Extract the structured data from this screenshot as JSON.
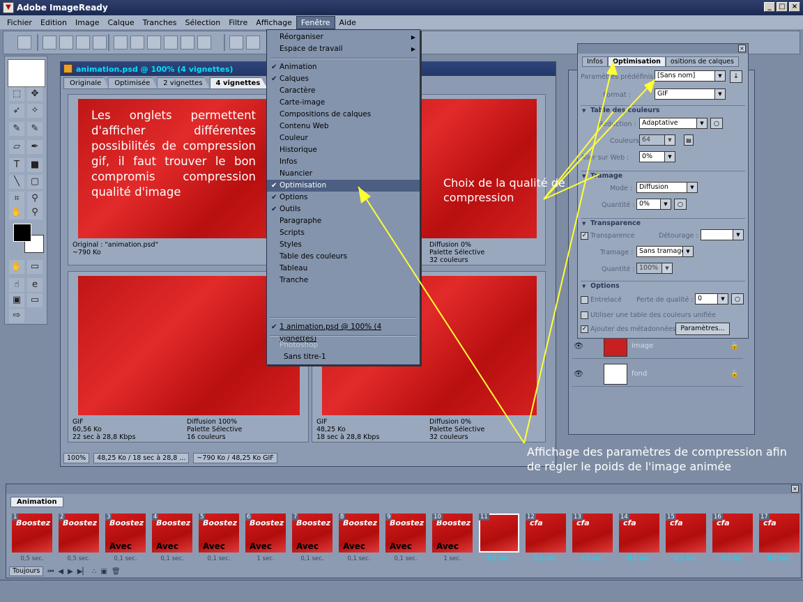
{
  "app": {
    "title": "Adobe ImageReady"
  },
  "menubar": [
    "Fichier",
    "Edition",
    "Image",
    "Calque",
    "Tranches",
    "Sélection",
    "Filtre",
    "Affichage",
    "Fenêtre",
    "Aide"
  ],
  "doc": {
    "title": "animation.psd @ 100% (4 vignettes)",
    "tabs": [
      "Originale",
      "Optimisée",
      "2 vignettes",
      "4 vignettes"
    ],
    "overlay_text": "Les onglets permettent d'afficher différentes possibilités de compression gif, il faut trouver le bon compromis compression qualité d'image",
    "pane1": {
      "l1": "Original : \"animation.psd\"",
      "l2": "~790 Ko"
    },
    "pane2": {
      "r1": "Diffusion 0%",
      "r2": "Palette Sélective",
      "r3": "32 couleurs"
    },
    "pane3": {
      "l1": "GIF",
      "l2": "60,56 Ko",
      "l3": "22 sec à 28,8 Kbps",
      "r1": "Diffusion 100%",
      "r2": "Palette Sélective",
      "r3": "16 couleurs"
    },
    "pane4": {
      "l1": "GIF",
      "l2": "48,25 Ko",
      "l3": "18 sec à 28,8 Kbps",
      "r1": "Diffusion 0%",
      "r2": "Palette Sélective",
      "r3": "32 couleurs"
    },
    "status": {
      "zoom": "100%",
      "size1": "48,25 Ko / 18 sec à 28,8 ...",
      "size2": "~790 Ko / 48,25 Ko GIF"
    }
  },
  "menu_fenetre": {
    "reorganiser": "Réorganiser",
    "espace": "Espace de travail",
    "items": [
      {
        "label": "Animation",
        "checked": true
      },
      {
        "label": "Calques",
        "checked": true
      },
      {
        "label": "Caractère",
        "checked": false
      },
      {
        "label": "Carte-image",
        "checked": false
      },
      {
        "label": "Compositions de calques",
        "checked": false
      },
      {
        "label": "Contenu Web",
        "checked": false
      },
      {
        "label": "Couleur",
        "checked": false
      },
      {
        "label": "Historique",
        "checked": false
      },
      {
        "label": "Infos",
        "checked": false
      },
      {
        "label": "Nuancier",
        "checked": false
      },
      {
        "label": "Optimisation",
        "checked": true
      },
      {
        "label": "Options",
        "checked": true
      },
      {
        "label": "Outils",
        "checked": true
      },
      {
        "label": "Paragraphe",
        "checked": false
      },
      {
        "label": "Scripts",
        "checked": false
      },
      {
        "label": "Styles",
        "checked": false
      },
      {
        "label": "Table des couleurs",
        "checked": false
      },
      {
        "label": "Tableau",
        "checked": false
      },
      {
        "label": "Tranche",
        "checked": false
      }
    ],
    "window_item": "1 animation.psd @ 100% (4 vignettes)",
    "photoshop": "Photoshop",
    "sans_titre": "Sans titre-1"
  },
  "optim": {
    "tabs": [
      "Infos",
      "Optimisation",
      "ositions de calques"
    ],
    "param_label": "Paramètres prédéfinis :",
    "param_value": "[Sans nom]",
    "format_label": "Format :",
    "format_value": "GIF",
    "sect_table": "Table des couleurs",
    "reduction_label": "Réduction :",
    "reduction_value": "Adaptative",
    "couleurs_label": "Couleurs :",
    "couleurs_value": "64",
    "aller_label": "Aller sur Web :",
    "aller_value": "0%",
    "sect_tramage": "Tramage",
    "mode_label": "Mode :",
    "mode_value": "Diffusion",
    "quantite_label": "Quantité :",
    "quantite_value": "0%",
    "sect_transparence": "Transparence",
    "transparence_label": "Transparence",
    "detourage_label": "Détourage :",
    "tramage_label": "Tramage :",
    "tramage_value": "Sans tramage",
    "quantite2_label": "Quantité :",
    "quantite2_value": "100%",
    "sect_options": "Options",
    "entrelace_label": "Entrelacé",
    "perte_label": "Perte de qualité :",
    "perte_value": "0",
    "table_unifiee_label": "Utiliser une table des couleurs unifiée",
    "metadonnees_label": "Ajouter des métadonnées",
    "parametres_button": "Paramètres..."
  },
  "layers": [
    {
      "name": "image"
    },
    {
      "name": "fond"
    }
  ],
  "annotations": {
    "choix": "Choix de la qualité de compression",
    "affichage": "Affichage des paramètres de compression afin de régler le poids de l'image animée"
  },
  "animation": {
    "tab": "Animation",
    "loop": "Toujours",
    "frames": [
      {
        "num": "1",
        "delay": "0,5 sec.",
        "t1": "Boostez",
        "t2": ""
      },
      {
        "num": "2",
        "delay": "0,5 sec.",
        "t1": "Boostez",
        "t2": ""
      },
      {
        "num": "3",
        "delay": "0,1 sec.",
        "t1": "Boostez",
        "t2": "Avec"
      },
      {
        "num": "4",
        "delay": "0,1 sec.",
        "t1": "Boostez",
        "t2": "Avec"
      },
      {
        "num": "5",
        "delay": "0,1 sec.",
        "t1": "Boostez",
        "t2": "Avec"
      },
      {
        "num": "6",
        "delay": "1 sec.",
        "t1": "Boostez",
        "t2": "Avec"
      },
      {
        "num": "7",
        "delay": "0,1 sec.",
        "t1": "Boostez",
        "t2": "Avec"
      },
      {
        "num": "8",
        "delay": "0,1 sec.",
        "t1": "Boostez",
        "t2": "Avec"
      },
      {
        "num": "9",
        "delay": "0,1 sec.",
        "t1": "Boostez",
        "t2": "Avec"
      },
      {
        "num": "10",
        "delay": "1 sec.",
        "t1": "Boostez",
        "t2": "Avec"
      },
      {
        "num": "11",
        "delay": "0,2 sec.",
        "t1": "",
        "t2": ""
      },
      {
        "num": "12",
        "delay": "0,2 sec.",
        "t1": "cfa",
        "t2": ""
      },
      {
        "num": "13",
        "delay": "0,2 sec.",
        "t1": "cfa",
        "t2": ""
      },
      {
        "num": "14",
        "delay": "0,2 sec.",
        "t1": "cfa",
        "t2": ""
      },
      {
        "num": "15",
        "delay": "0,2 sec.",
        "t1": "cfa",
        "t2": ""
      },
      {
        "num": "16",
        "delay": "0,2 sec.",
        "t1": "cfa",
        "t2": ""
      },
      {
        "num": "17",
        "delay": "0,2 sec.",
        "t1": "cfa",
        "t2": ""
      }
    ]
  },
  "colors": {
    "highlight_text": "#00e0ff",
    "arrow": "#ffff33",
    "title_bg": "#1b2a52"
  }
}
